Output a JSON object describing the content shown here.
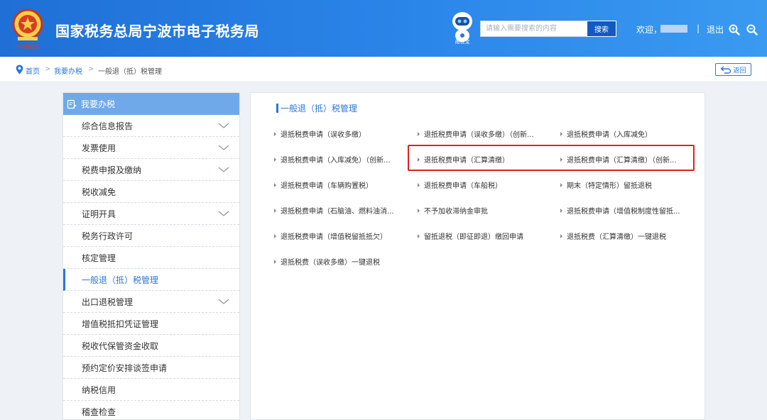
{
  "header": {
    "site_title": "国家税务总局宁波市电子税务局",
    "seal_text": "中国税务",
    "robot_label": "甬税宝",
    "search_placeholder": "请输入需要搜索的内容",
    "search_button": "搜索",
    "welcome": "欢迎，",
    "divider": "|",
    "logout": "退出",
    "colors": {
      "header_start": "#1f6fd6",
      "header_end": "#3a9af0",
      "accent": "#2a77d4"
    }
  },
  "breadcrumb": {
    "home": "首页",
    "sep1": ">",
    "level2": "我要办税",
    "sep2": ">",
    "current": "一般退（抵）税管理",
    "back": "返回"
  },
  "sidebar": {
    "title": "我要办税",
    "items": [
      {
        "label": "综合信息报告",
        "expandable": true
      },
      {
        "label": "发票使用",
        "expandable": true
      },
      {
        "label": "税费申报及缴纳",
        "expandable": true
      },
      {
        "label": "税收减免",
        "expandable": false
      },
      {
        "label": "证明开具",
        "expandable": true
      },
      {
        "label": "税务行政许可",
        "expandable": false
      },
      {
        "label": "核定管理",
        "expandable": false
      },
      {
        "label": "一般退（抵）税管理",
        "expandable": false,
        "active": true
      },
      {
        "label": "出口退税管理",
        "expandable": true
      },
      {
        "label": "增值税抵扣凭证管理",
        "expandable": false
      },
      {
        "label": "税收代保管资金收取",
        "expandable": false
      },
      {
        "label": "预约定价安排谈签申请",
        "expandable": false
      },
      {
        "label": "纳税信用",
        "expandable": false
      },
      {
        "label": "稽查检查",
        "expandable": false
      }
    ]
  },
  "main": {
    "title": "一般退（抵）税管理",
    "links": [
      "退抵税费申请（误收多缴）",
      "退抵税费申请（误收多缴）（创新...",
      "退抵税费申请（入库减免）",
      "退抵税费申请（入库减免）（创新...",
      "退抵税费申请（汇算清缴）",
      "退抵税费申请（汇算清缴）（创新...",
      "退抵税费申请（车辆购置税）",
      "退抵税费申请（车船税）",
      "期末（特定情形）留抵退税",
      "退抵税费申请（石脑油、燃料油消...",
      "不予加收滞纳金审批",
      "退抵税费申请（增值税制度性留抵...",
      "退抵税费申请（增值税留抵抵欠）",
      "留抵退税（即征即退）缴回申请",
      "退抵税费（汇算清缴）一键退税",
      "退抵税费（误收多缴）一键退税"
    ]
  }
}
